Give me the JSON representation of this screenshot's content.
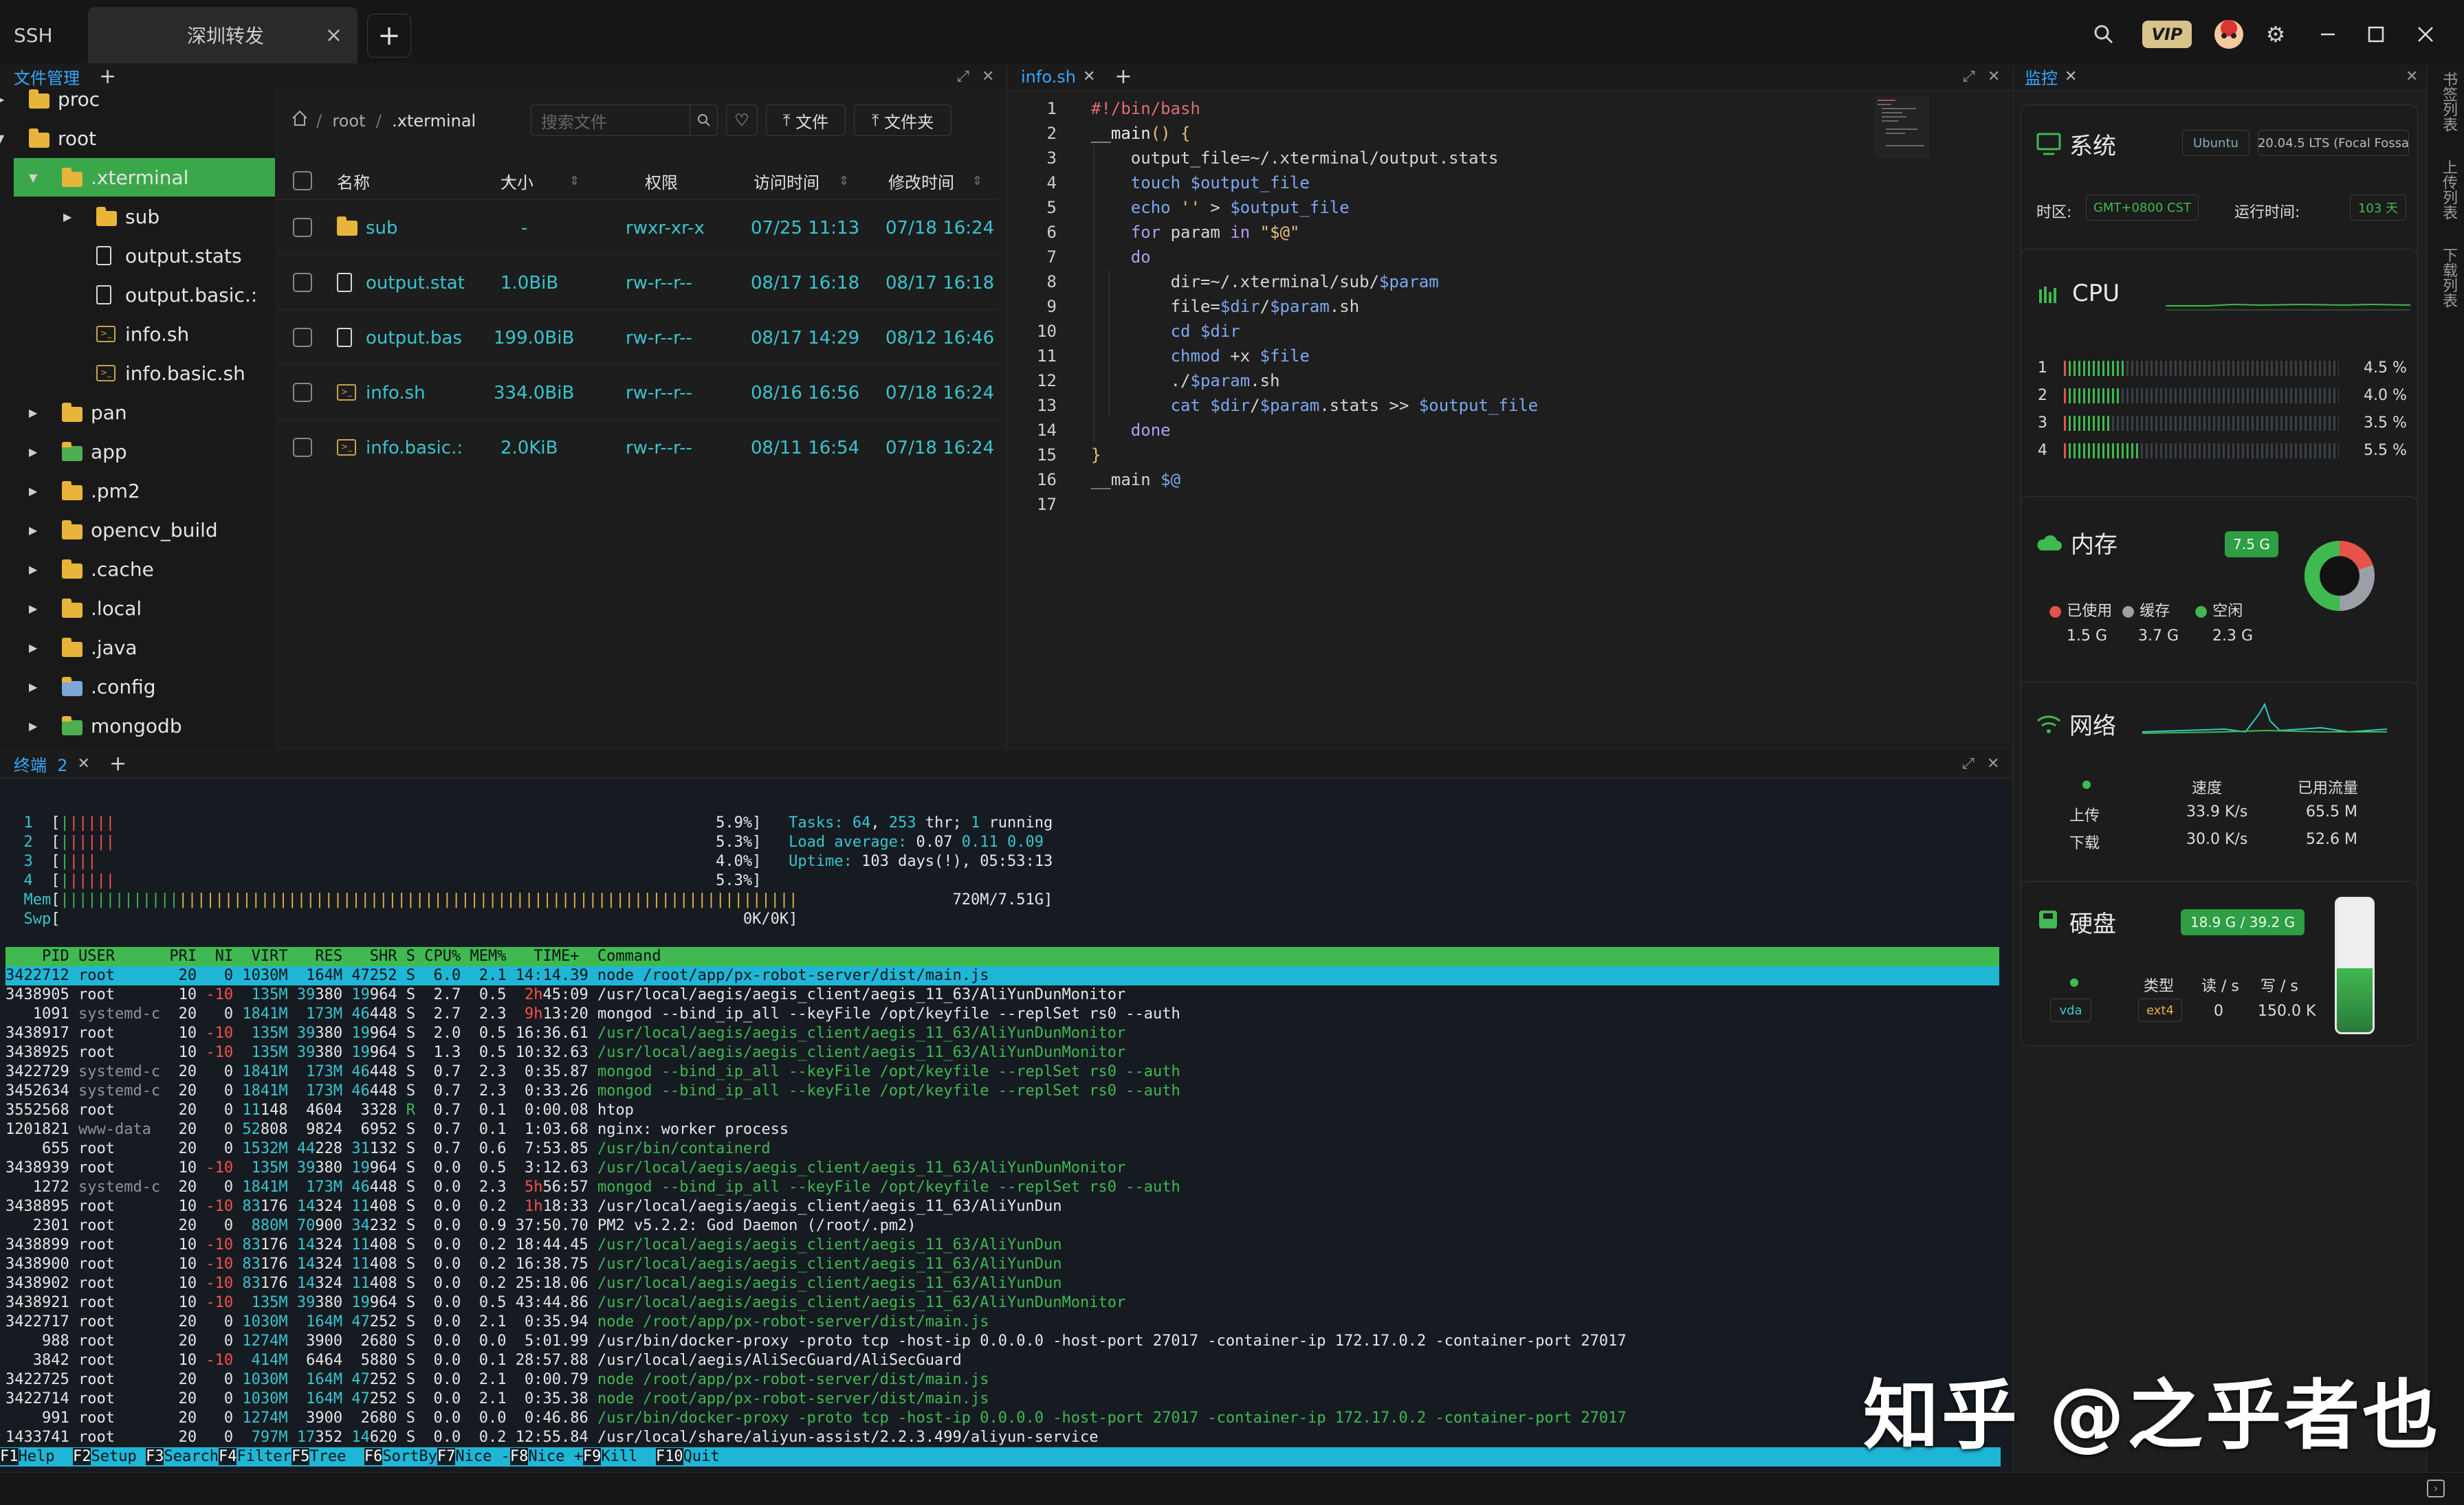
{
  "top_tabs": {
    "ssh": "SSH",
    "session": "深圳转发",
    "close": "×",
    "new": "+"
  },
  "file_manager": {
    "tab": "文件管理",
    "tree": [
      {
        "label": "proc",
        "type": "folder",
        "depth": 1
      },
      {
        "label": "root",
        "type": "folder",
        "depth": 1
      },
      {
        "label": ".xterminal",
        "type": "folder",
        "depth": 2,
        "selected": true
      },
      {
        "label": "sub",
        "type": "folder",
        "depth": 3
      },
      {
        "label": "output.stats",
        "type": "file",
        "depth": 3
      },
      {
        "label": "output.basic.:",
        "type": "file",
        "depth": 3
      },
      {
        "label": "info.sh",
        "type": "script",
        "depth": 3
      },
      {
        "label": "info.basic.sh",
        "type": "script",
        "depth": 3
      },
      {
        "label": "pan",
        "type": "folder",
        "depth": 2
      },
      {
        "label": "app",
        "type": "folder-green",
        "depth": 2
      },
      {
        "label": ".pm2",
        "type": "folder",
        "depth": 2
      },
      {
        "label": "opencv_build",
        "type": "folder",
        "depth": 2
      },
      {
        "label": ".cache",
        "type": "folder",
        "depth": 2
      },
      {
        "label": ".local",
        "type": "folder",
        "depth": 2
      },
      {
        "label": ".java",
        "type": "folder",
        "depth": 2
      },
      {
        "label": ".config",
        "type": "folder-blue",
        "depth": 2
      },
      {
        "label": "mongodb",
        "type": "folder-green",
        "depth": 2
      }
    ],
    "breadcrumb": [
      "root",
      ".xterminal"
    ],
    "search_placeholder": "搜索文件",
    "btn_file": "文件",
    "btn_folder": "文件夹",
    "columns": [
      "名称",
      "大小",
      "权限",
      "访问时间",
      "修改时间"
    ],
    "rows": [
      {
        "name": "sub",
        "size": "-",
        "perm": "rwxr-xr-x",
        "atime": "07/25 11:13",
        "mtime": "07/18 16:24",
        "type": "folder"
      },
      {
        "name": "output.stat",
        "size": "1.0BiB",
        "perm": "rw-r--r--",
        "atime": "08/17 16:18",
        "mtime": "08/17 16:18",
        "type": "file"
      },
      {
        "name": "output.bas",
        "size": "199.0BiB",
        "perm": "rw-r--r--",
        "atime": "08/17 14:29",
        "mtime": "08/12 16:46",
        "type": "file"
      },
      {
        "name": "info.sh",
        "size": "334.0BiB",
        "perm": "rw-r--r--",
        "atime": "08/16 16:56",
        "mtime": "07/18 16:24",
        "type": "script"
      },
      {
        "name": "info.basic.:",
        "size": "2.0KiB",
        "perm": "rw-r--r--",
        "atime": "08/11 16:54",
        "mtime": "07/18 16:24",
        "type": "script"
      }
    ]
  },
  "editor": {
    "tab": "info.sh",
    "lines": [
      {
        "n": "1",
        "html": "<span class='cm'>#!/bin/bash</span>"
      },
      {
        "n": "2",
        "html": "<span class='fn'>__main</span><span class='str'>() {</span>"
      },
      {
        "n": "3",
        "html": "    output_file=~/.xterminal/output.stats"
      },
      {
        "n": "4",
        "html": "    <span class='var'>touch</span> <span class='var'>$output_file</span>"
      },
      {
        "n": "5",
        "html": "    <span class='var'>echo</span> <span class='str'>''</span> &gt; <span class='var'>$output_file</span>"
      },
      {
        "n": "6",
        "html": "    <span class='kw'>for</span> param <span class='kw'>in</span> <span class='str'>\"$@\"</span>"
      },
      {
        "n": "7",
        "html": "    <span class='kw'>do</span>"
      },
      {
        "n": "8",
        "html": "        dir=~/.xterminal/sub/<span class='var'>$param</span>"
      },
      {
        "n": "9",
        "html": "        file=<span class='var'>$dir</span>/<span class='var'>$param</span>.sh"
      },
      {
        "n": "10",
        "html": "        <span class='var'>cd</span> <span class='var'>$dir</span>"
      },
      {
        "n": "11",
        "html": "        <span class='var'>chmod</span> +x <span class='var'>$file</span>"
      },
      {
        "n": "12",
        "html": "        ./<span class='var'>$param</span>.sh"
      },
      {
        "n": "13",
        "html": "        <span class='var'>cat</span> <span class='var'>$dir</span>/<span class='var'>$param</span>.stats &gt;&gt; <span class='var'>$output_file</span>"
      },
      {
        "n": "14",
        "html": "    <span class='kw'>done</span>"
      },
      {
        "n": "15",
        "html": "<span class='str'>}</span>"
      },
      {
        "n": "16",
        "html": "__main <span class='var'>$@</span>"
      },
      {
        "n": "17",
        "html": ""
      }
    ]
  },
  "terminal": {
    "tab": "终端",
    "count": "2",
    "header_lines": [
      "<span class='c'>  1  </span>[<span class='g'>|</span><span class='r'>|||||</span>                                                                  5.9%]   <span class='c'>Tasks: </span><span class='c'>64</span>, <span class='c'>253</span> thr; <span class='c'>1</span> running",
      "<span class='c'>  2  </span>[<span class='g'>|</span><span class='r'>|||||</span>                                                                  5.3%]   <span class='c'>Load average: </span>0.07 <span class='c'>0.11</span> <span class='c'>0.09</span>",
      "<span class='c'>  3  </span>[<span class='g'>|</span><span class='r'>|||</span>                                                                    4.0%]   <span class='c'>Uptime: </span>103 days(!), 05:53:13",
      "<span class='c'>  4  </span>[<span class='g'>|</span><span class='r'>|||||</span>                                                                  5.3%]",
      "<span class='c'>  Mem</span>[<span class='g'>|||||||||||||</span><span class='y'>||||||||||||||||||||||||||||||||||||||||||||||||||||||||||||||||||||</span>                 720M/7.51G]",
      "<span class='c'>  Swp</span>[                                                                           0K/0K]"
    ],
    "table_header": "    PID USER      PRI  NI  VIRT   RES   SHR S CPU% MEM%   TIME+  Command",
    "selected_line": "3422712 root       20   0 1030M  164M 47252 S  6.0  2.1 14:14.39 node /root/app/px-robot-server/dist/main.js",
    "procs": [
      "3438905 root       10 <span class='r'>-10</span>  <span class='c'>135M</span> <span class='c'>39</span>380 <span class='c'>19</span>964 S  2.7  0.5  <span class='r'>2h</span>45:09 /usr/local/aegis/aegis_client/aegis_11_63/AliYunDunMonitor",
      "   1091 <span class='gr'>systemd-c</span>  20   0 <span class='c'>1841M</span>  <span class='c'>173M</span> <span class='c'>46</span>448 S  2.7  2.3  <span class='r'>9h</span>13:20 mongod --bind_ip_all --keyFile /opt/keyfile --replSet rs0 --auth",
      "3438917 root       10 <span class='r'>-10</span>  <span class='c'>135M</span> <span class='c'>39</span>380 <span class='c'>19</span>964 S  2.0  0.5 16:36.61 <span class='g'>/usr/local/aegis/aegis_client/aegis_11_63/AliYunDunMonitor</span>",
      "3438925 root       10 <span class='r'>-10</span>  <span class='c'>135M</span> <span class='c'>39</span>380 <span class='c'>19</span>964 S  1.3  0.5 10:32.63 <span class='g'>/usr/local/aegis/aegis_client/aegis_11_63/AliYunDunMonitor</span>",
      "3422729 <span class='gr'>systemd-c</span>  20   0 <span class='c'>1841M</span>  <span class='c'>173M</span> <span class='c'>46</span>448 S  0.7  2.3  0:35.87 <span class='g'>mongod --bind_ip_all --keyFile /opt/keyfile --replSet rs0 --auth</span>",
      "3452634 <span class='gr'>systemd-c</span>  20   0 <span class='c'>1841M</span>  <span class='c'>173M</span> <span class='c'>46</span>448 S  0.7  2.3  0:33.26 <span class='g'>mongod --bind_ip_all --keyFile /opt/keyfile --replSet rs0 --auth</span>",
      "3552568 root       20   0 <span class='c'>11</span>148  4604  3328 <span class='g'>R</span>  0.7  0.1  0:00.08 htop",
      "1201821 <span class='gr'>www-data</span>   20   0 <span class='c'>52</span>808  9824  6952 S  0.7  0.1  1:03.68 nginx: worker process",
      "    655 root       20   0 <span class='c'>1532M</span> <span class='c'>44</span>228 <span class='c'>31</span>132 S  0.7  0.6  7:53.85 <span class='g'>/usr/bin/containerd</span>",
      "3438939 root       10 <span class='r'>-10</span>  <span class='c'>135M</span> <span class='c'>39</span>380 <span class='c'>19</span>964 S  0.0  0.5  3:12.63 <span class='g'>/usr/local/aegis/aegis_client/aegis_11_63/AliYunDunMonitor</span>",
      "   1272 <span class='gr'>systemd-c</span>  20   0 <span class='c'>1841M</span>  <span class='c'>173M</span> <span class='c'>46</span>448 S  0.0  2.3  <span class='r'>5h</span>56:57 <span class='g'>mongod --bind_ip_all --keyFile /opt/keyfile --replSet rs0 --auth</span>",
      "3438895 root       10 <span class='r'>-10</span> <span class='c'>83</span>176 <span class='c'>14</span>324 <span class='c'>11</span>408 S  0.0  0.2  <span class='r'>1h</span>18:33 /usr/local/aegis/aegis_client/aegis_11_63/AliYunDun",
      "   2301 root       20   0  <span class='c'>880M</span> <span class='c'>70</span>900 <span class='c'>34</span>232 S  0.0  0.9 37:50.70 PM2 v5.2.2: God Daemon (/root/.pm2)",
      "3438899 root       10 <span class='r'>-10</span> <span class='c'>83</span>176 <span class='c'>14</span>324 <span class='c'>11</span>408 S  0.0  0.2 18:44.45 <span class='g'>/usr/local/aegis/aegis_client/aegis_11_63/AliYunDun</span>",
      "3438900 root       10 <span class='r'>-10</span> <span class='c'>83</span>176 <span class='c'>14</span>324 <span class='c'>11</span>408 S  0.0  0.2 16:38.75 <span class='g'>/usr/local/aegis/aegis_client/aegis_11_63/AliYunDun</span>",
      "3438902 root       10 <span class='r'>-10</span> <span class='c'>83</span>176 <span class='c'>14</span>324 <span class='c'>11</span>408 S  0.0  0.2 25:18.06 <span class='g'>/usr/local/aegis/aegis_client/aegis_11_63/AliYunDun</span>",
      "3438921 root       10 <span class='r'>-10</span>  <span class='c'>135M</span> <span class='c'>39</span>380 <span class='c'>19</span>964 S  0.0  0.5 43:44.86 <span class='g'>/usr/local/aegis/aegis_client/aegis_11_63/AliYunDunMonitor</span>",
      "3422717 root       20   0 <span class='c'>1030M</span>  <span class='c'>164M</span> <span class='c'>47</span>252 S  0.0  2.1  0:35.94 <span class='g'>node /root/app/px-robot-server/dist/main.js</span>",
      "    988 root       20   0 <span class='c'>1274M</span>  3900  2680 S  0.0  0.0  5:01.99 /usr/bin/docker-proxy -proto tcp -host-ip 0.0.0.0 -host-port 27017 -container-ip 172.17.0.2 -container-port 27017",
      "   3842 root       10 <span class='r'>-10</span>  <span class='c'>414M</span>  6464  5880 S  0.0  0.1 28:57.88 /usr/local/aegis/AliSecGuard/AliSecGuard",
      "3422725 root       20   0 <span class='c'>1030M</span>  <span class='c'>164M</span> <span class='c'>47</span>252 S  0.0  2.1  0:00.79 <span class='g'>node /root/app/px-robot-server/dist/main.js</span>",
      "3422714 root       20   0 <span class='c'>1030M</span>  <span class='c'>164M</span> <span class='c'>47</span>252 S  0.0  2.1  0:35.38 <span class='g'>node /root/app/px-robot-server/dist/main.js</span>",
      "    991 root       20   0 <span class='c'>1274M</span>  3900  2680 S  0.0  0.0  0:46.86 <span class='g'>/usr/bin/docker-proxy -proto tcp -host-ip 0.0.0.0 -host-port 27017 -container-ip 172.17.0.2 -container-port 27017</span>",
      "1433741 root       20   0  <span class='c'>797M</span> <span class='c'>17</span>352 <span class='c'>14</span>620 S  0.0  0.2 12:55.84 /usr/local/share/aliyun-assist/2.2.3.499/aliyun-service"
    ],
    "fkeys": [
      {
        "k": "F1",
        "l": "Help  "
      },
      {
        "k": "F2",
        "l": "Setup "
      },
      {
        "k": "F3",
        "l": "Search"
      },
      {
        "k": "F4",
        "l": "Filter"
      },
      {
        "k": "F5",
        "l": "Tree  "
      },
      {
        "k": "F6",
        "l": "SortBy"
      },
      {
        "k": "F7",
        "l": "Nice -"
      },
      {
        "k": "F8",
        "l": "Nice +"
      },
      {
        "k": "F9",
        "l": "Kill  "
      },
      {
        "k": "F10",
        "l": "Quit"
      }
    ]
  },
  "monitor": {
    "tab": "监控",
    "system": {
      "title": "系统",
      "os": "Ubuntu",
      "version": "20.04.5 LTS (Focal Fossa",
      "tz_label": "时区:",
      "tz": "GMT+0800  CST",
      "uptime_label": "运行时间:",
      "uptime": "103 天"
    },
    "cpu": {
      "title": "CPU",
      "cores": [
        {
          "id": "1",
          "pct": "4.5 %",
          "v": 0.045
        },
        {
          "id": "2",
          "pct": "4.0 %",
          "v": 0.04
        },
        {
          "id": "3",
          "pct": "3.5 %",
          "v": 0.035
        },
        {
          "id": "4",
          "pct": "5.5 %",
          "v": 0.055
        }
      ]
    },
    "memory": {
      "title": "内存",
      "total": "7.5 G",
      "used_label": "已使用",
      "cache_label": "缓存",
      "free_label": "空闲",
      "used": "1.5 G",
      "cache": "3.7 G",
      "free": "2.3 G"
    },
    "network": {
      "title": "网络",
      "speed_label": "速度",
      "traffic_label": "已用流量",
      "up_label": "上传",
      "down_label": "下载",
      "up_speed": "33.9 K/s",
      "down_speed": "30.0 K/s",
      "up_total": "65.5 M",
      "down_total": "52.6 M"
    },
    "disk": {
      "title": "硬盘",
      "usage": "18.9 G / 39.2 G",
      "type_label": "类型",
      "read_label": "读 / s",
      "write_label": "写 / s",
      "dev": "vda",
      "fs": "ext4",
      "read": "0",
      "write": "150.0 K",
      "fill": 0.48
    }
  },
  "right_strip": [
    "书签列表",
    "上传列表",
    "下载列表"
  ],
  "watermark": "知乎 @之乎者也",
  "colors": {
    "accent_green": "#3fb950",
    "accent_blue": "#35a9ff",
    "selection_cyan": "#1fb6d6"
  }
}
